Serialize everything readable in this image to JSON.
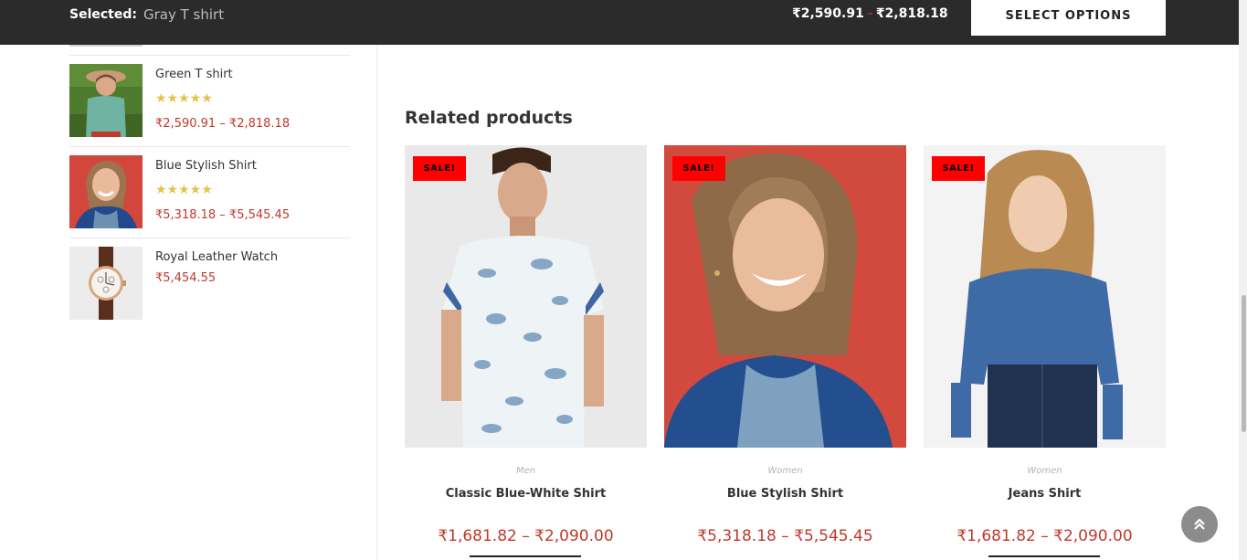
{
  "sticky_bar": {
    "selected_label": "Selected:",
    "selected_value": "Gray T shirt",
    "price_low": "₹2,590.91",
    "price_dash": "–",
    "price_high": "₹2,818.18",
    "select_options_label": "SELECT OPTIONS"
  },
  "sidebar": {
    "products": [
      {
        "title": "Green T shirt",
        "rating": "★★★★★",
        "price": "₹2,590.91 – ₹2,818.18",
        "image_icon": "man-lying-on-grass"
      },
      {
        "title": "Blue Stylish Shirt",
        "rating": "★★★★★",
        "price": "₹5,318.18 – ₹5,545.45",
        "image_icon": "smiling-woman-denim-jacket"
      },
      {
        "title": "Royal Leather Watch",
        "rating": "",
        "price": "₹5,454.55",
        "image_icon": "leather-wrist-watch"
      }
    ]
  },
  "related": {
    "title": "Related products",
    "products": [
      {
        "badge": "SALE!",
        "category": "Men",
        "title": "Classic Blue-White Shirt",
        "price": "₹1,681.82 – ₹2,090.00"
      },
      {
        "badge": "SALE!",
        "category": "Women",
        "title": "Blue Stylish Shirt",
        "price": "₹5,318.18 – ₹5,545.45"
      },
      {
        "badge": "SALE!",
        "category": "Women",
        "title": "Jeans Shirt",
        "price": "₹1,681.82 – ₹2,090.00"
      }
    ]
  },
  "back_to_top_icon": "double-chevron-up-icon",
  "colors": {
    "accent_price": "#c0392b",
    "sale_badge": "#ff0000",
    "sticky_bar_bg": "#2b2b2b",
    "stars": "#e6c14a"
  }
}
